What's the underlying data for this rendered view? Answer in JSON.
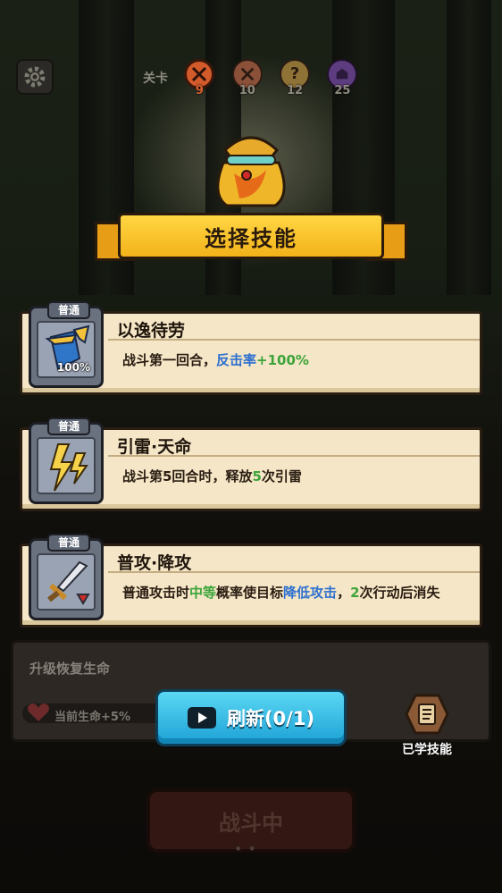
{
  "top": {
    "stage_label": "关卡",
    "stages": [
      {
        "num": "9",
        "color": "#d35a2a",
        "current": true
      },
      {
        "num": "10",
        "color": "#b26040",
        "current": false
      },
      {
        "num": "12",
        "color": "#b08a40",
        "current": false
      },
      {
        "num": "25",
        "color": "#7b4ba0",
        "current": false
      }
    ]
  },
  "banner": {
    "title": "选择技能"
  },
  "cards": [
    {
      "tag": "普通",
      "title": "以逸待劳",
      "icon": "shield-arrow-icon",
      "icon_pct": "100%",
      "desc_parts": [
        {
          "text": "战斗第一回合，",
          "style": "plain"
        },
        {
          "text": "反击率",
          "style": "blue"
        },
        {
          "text": "+100%",
          "style": "green"
        }
      ]
    },
    {
      "tag": "普通",
      "title": "引雷·天命",
      "icon": "lightning-icon",
      "icon_pct": "",
      "desc_parts": [
        {
          "text": "战斗第5回合时，释放",
          "style": "plain"
        },
        {
          "text": "5",
          "style": "green"
        },
        {
          "text": "次引雷",
          "style": "plain"
        }
      ]
    },
    {
      "tag": "普通",
      "title": "普攻·降攻",
      "icon": "sword-icon",
      "icon_pct": "",
      "desc_parts": [
        {
          "text": "普通攻击时",
          "style": "plain"
        },
        {
          "text": "中等",
          "style": "green"
        },
        {
          "text": "概率使目标",
          "style": "plain"
        },
        {
          "text": "降低攻击",
          "style": "blue"
        },
        {
          "text": "，",
          "style": "plain"
        },
        {
          "text": "2",
          "style": "green"
        },
        {
          "text": "次行动后消失",
          "style": "plain"
        }
      ]
    }
  ],
  "panel": {
    "title": "升级恢复生命",
    "hp_text": "当前生命+5%"
  },
  "refresh": {
    "label": "刷新(0/1)"
  },
  "learned": {
    "label": "已学技能"
  },
  "battle": {
    "label": "战斗中"
  }
}
